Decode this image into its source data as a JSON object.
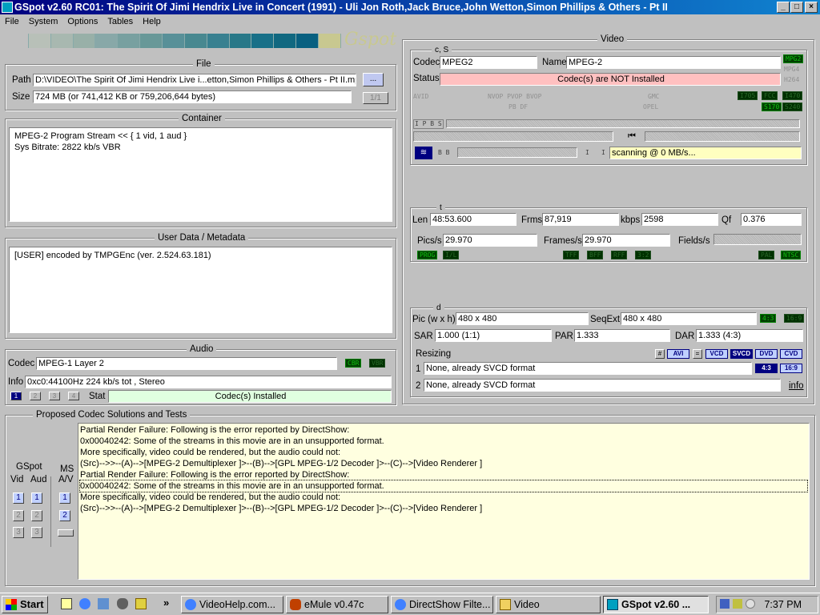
{
  "window": {
    "title": "GSpot v2.60 RC01: The Spirit Of Jimi Hendrix Live in Concert (1991) - Uli Jon Roth,Jack Bruce,John Wetton,Simon Phillips & Others - Pt II",
    "min": "_",
    "max": "□",
    "close": "×"
  },
  "menu": {
    "file": "File",
    "system": "System",
    "options": "Options",
    "tables": "Tables",
    "help": "Help"
  },
  "logo": "Gspot",
  "file": {
    "title": "File",
    "path_label": "Path",
    "path": "D:\\VIDEO\\The Spirit Of Jimi Hendrix Live i...etton,Simon Phillips & Others - Pt II.mpg",
    "browse": "...",
    "size_label": "Size",
    "size": "724 MB (or 741,412 KB or 759,206,644 bytes)",
    "page": "1/1"
  },
  "container": {
    "title": "Container",
    "line1": "MPEG-2 Program Stream << { 1 vid, 1 aud }",
    "line2": "Sys Bitrate: 2822 kb/s VBR"
  },
  "userdata": {
    "title": "User Data / Metadata",
    "line1": "[USER]    encoded by TMPGEnc (ver. 2.524.63.181)"
  },
  "audio": {
    "title": "Audio",
    "codec_label": "Codec",
    "codec": "MPEG-1 Layer 2",
    "cbr": "CBR",
    "vbr": "VBR",
    "info_label": "Info",
    "info": "0xc0:44100Hz  224 kb/s tot , Stereo",
    "stat_label": "Stat",
    "stat": "Codec(s) Installed",
    "tracks": [
      "1",
      "2",
      "3",
      "4"
    ]
  },
  "video": {
    "title": "Video",
    "cs_title": "c, S",
    "codec_label": "Codec",
    "codec": "MPEG2",
    "name_label": "Name",
    "name": "MPEG-2",
    "status_label": "Status",
    "status": "Codec(s) are NOT Installed",
    "fmt_mpg2": "MPG2",
    "fmt_mpg4": "MPG4",
    "fmt_h264": "H264",
    "avid": "AVID",
    "nvop": "NVOP  PVOP  BVOP",
    "pbdf": "PB DF",
    "gmc": "GMC",
    "opel": "OPEL",
    "i705": "I705",
    "fcc": "FCC",
    "i470": "I470",
    "s170": "S170",
    "s240": "S240",
    "ipb": "I P B S",
    "bb": "B B",
    "ii": "I",
    "scanning": "scanning @ 0 MB/s..."
  },
  "timing": {
    "title": "t",
    "len_label": "Len",
    "len": "48:53.600",
    "frms_label": "Frms",
    "frms": "87,919",
    "kbps_label": "kbps",
    "kbps": "2598",
    "qf_label": "Qf",
    "qf": "0.376",
    "pics_label": "Pics/s",
    "pics": "29.970",
    "frames_label": "Frames/s",
    "frames": "29.970",
    "fields_label": "Fields/s",
    "prog": "PROG",
    "il": "I/L",
    "tff": "TFF",
    "bff": "BFF",
    "rff": "RFF",
    "ratio32": "3:2",
    "pal": "PAL",
    "ntsc": "NTSC"
  },
  "dims": {
    "title": "d",
    "pic_label": "Pic (w x h)",
    "pic": "480 x 480",
    "seqext_label": "SeqExt",
    "seqext": "480 x 480",
    "ar43": "4:3",
    "ar169": "16:9",
    "sar_label": "SAR",
    "sar": "1.000 (1:1)",
    "par_label": "PAR",
    "par": "1.333",
    "dar_label": "DAR",
    "dar": "1.333 (4:3)",
    "resizing_label": "Resizing",
    "tabs": [
      "AVI",
      "VCD",
      "SVCD",
      "DVD",
      "CVD"
    ],
    "hash": "#",
    "eq": "=",
    "r1_label": "1",
    "r1": "None, already SVCD format",
    "r1_43": "4:3",
    "r1_169": "16:9",
    "r2_label": "2",
    "r2": "None, already SVCD format",
    "info": "info"
  },
  "proposed": {
    "title": "Proposed Codec Solutions and Tests",
    "gspot": "GSpot",
    "vid": "Vid",
    "aud": "Aud",
    "ms": "MS",
    "av": "A/V",
    "lines": [
      "Partial Render Failure: Following is the error reported by DirectShow:",
      "0x00040242: Some of the streams in this movie are in an unsupported format.",
      "More specifically, video could be rendered, but the audio could not:",
      "(Src)-->>--(A)-->[MPEG-2 Demultiplexer ]>--(B)-->[GPL MPEG-1/2 Decoder ]>--(C)-->[Video Renderer ]",
      "Partial Render Failure: Following is the error reported by DirectShow:",
      "0x00040242: Some of the streams in this movie are in an unsupported format.",
      "More specifically, video could be rendered, but the audio could not:",
      "(Src)-->>--(A)-->[MPEG-2 Demultiplexer ]>--(B)-->[GPL MPEG-1/2 Decoder ]>--(C)-->[Video Renderer ]"
    ]
  },
  "taskbar": {
    "start": "Start",
    "chevron": "»",
    "items": [
      "VideoHelp.com...",
      "eMule v0.47c",
      "DirectShow Filte...",
      "Video",
      "GSpot v2.60 ..."
    ],
    "clock": "7:37 PM"
  }
}
